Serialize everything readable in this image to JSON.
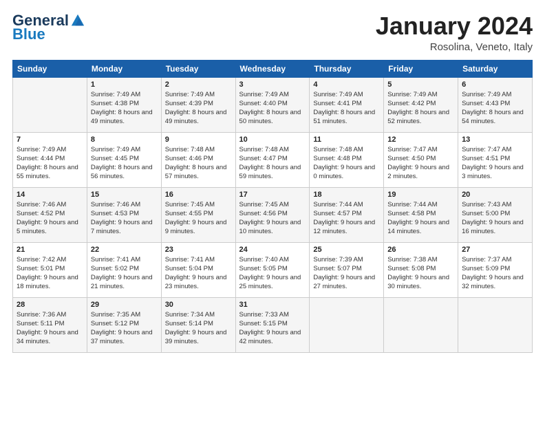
{
  "header": {
    "logo_general": "General",
    "logo_blue": "Blue",
    "cal_title": "January 2024",
    "cal_subtitle": "Rosolina, Veneto, Italy"
  },
  "weekdays": [
    "Sunday",
    "Monday",
    "Tuesday",
    "Wednesday",
    "Thursday",
    "Friday",
    "Saturday"
  ],
  "weeks": [
    [
      {
        "day": "",
        "sunrise": "",
        "sunset": "",
        "daylight": ""
      },
      {
        "day": "1",
        "sunrise": "Sunrise: 7:49 AM",
        "sunset": "Sunset: 4:38 PM",
        "daylight": "Daylight: 8 hours and 49 minutes."
      },
      {
        "day": "2",
        "sunrise": "Sunrise: 7:49 AM",
        "sunset": "Sunset: 4:39 PM",
        "daylight": "Daylight: 8 hours and 49 minutes."
      },
      {
        "day": "3",
        "sunrise": "Sunrise: 7:49 AM",
        "sunset": "Sunset: 4:40 PM",
        "daylight": "Daylight: 8 hours and 50 minutes."
      },
      {
        "day": "4",
        "sunrise": "Sunrise: 7:49 AM",
        "sunset": "Sunset: 4:41 PM",
        "daylight": "Daylight: 8 hours and 51 minutes."
      },
      {
        "day": "5",
        "sunrise": "Sunrise: 7:49 AM",
        "sunset": "Sunset: 4:42 PM",
        "daylight": "Daylight: 8 hours and 52 minutes."
      },
      {
        "day": "6",
        "sunrise": "Sunrise: 7:49 AM",
        "sunset": "Sunset: 4:43 PM",
        "daylight": "Daylight: 8 hours and 54 minutes."
      }
    ],
    [
      {
        "day": "7",
        "sunrise": "Sunrise: 7:49 AM",
        "sunset": "Sunset: 4:44 PM",
        "daylight": "Daylight: 8 hours and 55 minutes."
      },
      {
        "day": "8",
        "sunrise": "Sunrise: 7:49 AM",
        "sunset": "Sunset: 4:45 PM",
        "daylight": "Daylight: 8 hours and 56 minutes."
      },
      {
        "day": "9",
        "sunrise": "Sunrise: 7:48 AM",
        "sunset": "Sunset: 4:46 PM",
        "daylight": "Daylight: 8 hours and 57 minutes."
      },
      {
        "day": "10",
        "sunrise": "Sunrise: 7:48 AM",
        "sunset": "Sunset: 4:47 PM",
        "daylight": "Daylight: 8 hours and 59 minutes."
      },
      {
        "day": "11",
        "sunrise": "Sunrise: 7:48 AM",
        "sunset": "Sunset: 4:48 PM",
        "daylight": "Daylight: 9 hours and 0 minutes."
      },
      {
        "day": "12",
        "sunrise": "Sunrise: 7:47 AM",
        "sunset": "Sunset: 4:50 PM",
        "daylight": "Daylight: 9 hours and 2 minutes."
      },
      {
        "day": "13",
        "sunrise": "Sunrise: 7:47 AM",
        "sunset": "Sunset: 4:51 PM",
        "daylight": "Daylight: 9 hours and 3 minutes."
      }
    ],
    [
      {
        "day": "14",
        "sunrise": "Sunrise: 7:46 AM",
        "sunset": "Sunset: 4:52 PM",
        "daylight": "Daylight: 9 hours and 5 minutes."
      },
      {
        "day": "15",
        "sunrise": "Sunrise: 7:46 AM",
        "sunset": "Sunset: 4:53 PM",
        "daylight": "Daylight: 9 hours and 7 minutes."
      },
      {
        "day": "16",
        "sunrise": "Sunrise: 7:45 AM",
        "sunset": "Sunset: 4:55 PM",
        "daylight": "Daylight: 9 hours and 9 minutes."
      },
      {
        "day": "17",
        "sunrise": "Sunrise: 7:45 AM",
        "sunset": "Sunset: 4:56 PM",
        "daylight": "Daylight: 9 hours and 10 minutes."
      },
      {
        "day": "18",
        "sunrise": "Sunrise: 7:44 AM",
        "sunset": "Sunset: 4:57 PM",
        "daylight": "Daylight: 9 hours and 12 minutes."
      },
      {
        "day": "19",
        "sunrise": "Sunrise: 7:44 AM",
        "sunset": "Sunset: 4:58 PM",
        "daylight": "Daylight: 9 hours and 14 minutes."
      },
      {
        "day": "20",
        "sunrise": "Sunrise: 7:43 AM",
        "sunset": "Sunset: 5:00 PM",
        "daylight": "Daylight: 9 hours and 16 minutes."
      }
    ],
    [
      {
        "day": "21",
        "sunrise": "Sunrise: 7:42 AM",
        "sunset": "Sunset: 5:01 PM",
        "daylight": "Daylight: 9 hours and 18 minutes."
      },
      {
        "day": "22",
        "sunrise": "Sunrise: 7:41 AM",
        "sunset": "Sunset: 5:02 PM",
        "daylight": "Daylight: 9 hours and 21 minutes."
      },
      {
        "day": "23",
        "sunrise": "Sunrise: 7:41 AM",
        "sunset": "Sunset: 5:04 PM",
        "daylight": "Daylight: 9 hours and 23 minutes."
      },
      {
        "day": "24",
        "sunrise": "Sunrise: 7:40 AM",
        "sunset": "Sunset: 5:05 PM",
        "daylight": "Daylight: 9 hours and 25 minutes."
      },
      {
        "day": "25",
        "sunrise": "Sunrise: 7:39 AM",
        "sunset": "Sunset: 5:07 PM",
        "daylight": "Daylight: 9 hours and 27 minutes."
      },
      {
        "day": "26",
        "sunrise": "Sunrise: 7:38 AM",
        "sunset": "Sunset: 5:08 PM",
        "daylight": "Daylight: 9 hours and 30 minutes."
      },
      {
        "day": "27",
        "sunrise": "Sunrise: 7:37 AM",
        "sunset": "Sunset: 5:09 PM",
        "daylight": "Daylight: 9 hours and 32 minutes."
      }
    ],
    [
      {
        "day": "28",
        "sunrise": "Sunrise: 7:36 AM",
        "sunset": "Sunset: 5:11 PM",
        "daylight": "Daylight: 9 hours and 34 minutes."
      },
      {
        "day": "29",
        "sunrise": "Sunrise: 7:35 AM",
        "sunset": "Sunset: 5:12 PM",
        "daylight": "Daylight: 9 hours and 37 minutes."
      },
      {
        "day": "30",
        "sunrise": "Sunrise: 7:34 AM",
        "sunset": "Sunset: 5:14 PM",
        "daylight": "Daylight: 9 hours and 39 minutes."
      },
      {
        "day": "31",
        "sunrise": "Sunrise: 7:33 AM",
        "sunset": "Sunset: 5:15 PM",
        "daylight": "Daylight: 9 hours and 42 minutes."
      },
      {
        "day": "",
        "sunrise": "",
        "sunset": "",
        "daylight": ""
      },
      {
        "day": "",
        "sunrise": "",
        "sunset": "",
        "daylight": ""
      },
      {
        "day": "",
        "sunrise": "",
        "sunset": "",
        "daylight": ""
      }
    ]
  ]
}
